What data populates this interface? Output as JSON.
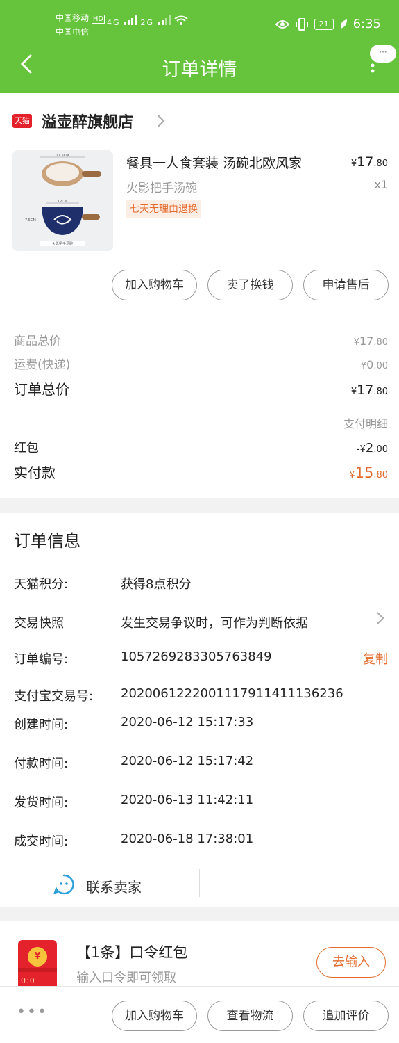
{
  "status": {
    "carrier1": "中国移动",
    "hd": "HD",
    "carrier2": "中国电信",
    "net1": "4G",
    "net2": "2G",
    "battery": "21",
    "time": "6:35"
  },
  "header": {
    "title": "订单详情",
    "bubble": "···"
  },
  "store": {
    "logo": "天猫",
    "name": "溢壶醉旗舰店"
  },
  "product": {
    "name": "餐具一人食套装 汤碗北欧风家",
    "spec": "火影把手汤碗",
    "tag": "七天无理由退换",
    "price_symbol": "¥",
    "price_int": "17",
    "price_dec": ".80",
    "qty": "x1",
    "thumb_dim1": "17.5CM",
    "thumb_dim2": "12CM",
    "thumb_dim3": "7.5CM",
    "thumb_caption": "火影把手汤碗"
  },
  "actions": {
    "add_cart": "加入购物车",
    "resell": "卖了换钱",
    "after_sale": "申请售后"
  },
  "summary": {
    "goods_label": "商品总价",
    "goods_sym": "¥",
    "goods_int": "17",
    "goods_dec": ".80",
    "ship_label": "运费(快递)",
    "ship_sym": "¥",
    "ship_int": "0",
    "ship_dec": ".00",
    "order_label": "订单总价",
    "order_sym": "¥",
    "order_int": "17",
    "order_dec": ".80",
    "pay_detail": "支付明细",
    "redpack_label": "红包",
    "redpack_sym": "-¥",
    "redpack_int": "2",
    "redpack_dec": ".00",
    "paid_label": "实付款",
    "paid_sym": "¥",
    "paid_int": "15",
    "paid_dec": ".80"
  },
  "order_info": {
    "title": "订单信息",
    "points_label": "天猫积分:",
    "points_value": "获得8点积分",
    "snapshot_label": "交易快照",
    "snapshot_value": "发生交易争议时，可作为判断依据",
    "order_no_label": "订单编号:",
    "order_no_value": "1057269283305763849",
    "copy": "复制",
    "alipay_label": "支付宝交易号:",
    "alipay_value": "2020061222001117911411136236",
    "created_label": "创建时间:",
    "created_value": "2020-06-12 15:17:33",
    "paid_label": "付款时间:",
    "paid_value": "2020-06-12 15:17:42",
    "shipped_label": "发货时间:",
    "shipped_value": "2020-06-13 11:42:11",
    "closed_label": "成交时间:",
    "closed_value": "2020-06-18 17:38:01",
    "contact": "联系卖家"
  },
  "redpacket": {
    "coin": "¥",
    "env_text": "0:0",
    "title": "【1条】口令红包",
    "sub": "输入口令即可领取",
    "button": "去输入"
  },
  "bottom": {
    "dots": "•••",
    "add_cart": "加入购物车",
    "logistics": "查看物流",
    "review": "追加评价"
  },
  "colors": {
    "header": "#65c43c",
    "accent": "#e26b2d",
    "tmall_red": "#e4222b"
  }
}
